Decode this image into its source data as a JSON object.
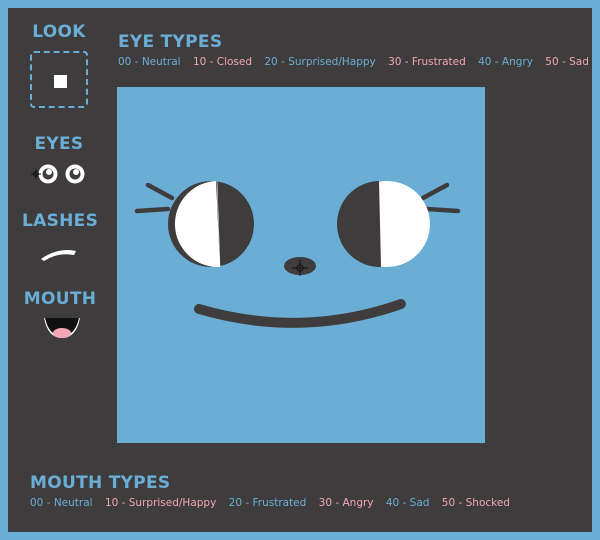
{
  "sidebar": {
    "look_label": "LOOK",
    "eyes_label": "EYES",
    "lashes_label": "LASHES",
    "mouth_label": "MOUTH"
  },
  "eye_types": {
    "title": "EYE TYPES",
    "items": [
      "00 - Neutral",
      "10 - Closed",
      "20 - Surprised/Happy",
      "30 - Frustrated",
      "40 - Angry",
      "50 - Sad"
    ]
  },
  "mouth_types": {
    "title": "MOUTH TYPES",
    "items": [
      "00 - Neutral",
      "10 - Surprised/Happy",
      "20 - Frustrated",
      "30 - Angry",
      "40 - Sad",
      "50 - Shocked"
    ]
  },
  "colors": {
    "frame": "#6aaed6",
    "panel": "#3f3c3d",
    "accent_blue": "#6aaed6",
    "accent_pink": "#f2a7b3",
    "face_dark": "#3f3c3d",
    "white": "#ffffff"
  }
}
